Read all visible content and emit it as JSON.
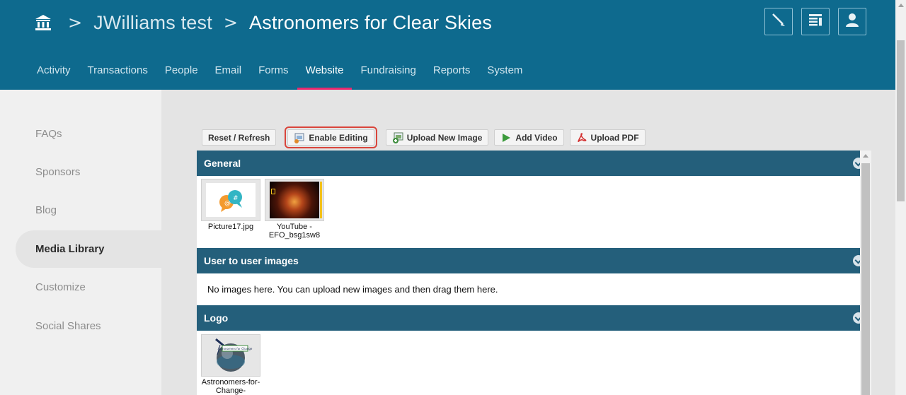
{
  "header": {
    "breadcrumb": [
      "JWilliams test",
      "Astronomers for Clear Skies"
    ],
    "separator": ">"
  },
  "nav": {
    "items": [
      "Activity",
      "Transactions",
      "People",
      "Email",
      "Forms",
      "Website",
      "Fundraising",
      "Reports",
      "System"
    ],
    "active": "Website"
  },
  "sidebar": {
    "items": [
      "FAQs",
      "Sponsors",
      "Blog",
      "Media Library",
      "Customize",
      "Social Shares"
    ],
    "active": "Media Library"
  },
  "toolbar": {
    "reset_label": "Reset / Refresh",
    "enable_editing_label": "Enable Editing",
    "upload_image_label": "Upload New Image",
    "add_video_label": "Add Video",
    "upload_pdf_label": "Upload PDF"
  },
  "sections": [
    {
      "title": "General",
      "items": [
        {
          "caption": "Picture17.jpg"
        },
        {
          "caption": "YouTube - EFO_bsg1sw8"
        }
      ]
    },
    {
      "title": "User to user images",
      "empty_message": "No images here. You can upload new images and then drag them here."
    },
    {
      "title": "Logo",
      "items": [
        {
          "caption": "Astronomers-for-Change-"
        }
      ]
    }
  ],
  "colors": {
    "header_bg": "#0e6a8e",
    "section_header_bg": "#245f7b",
    "active_underline": "#e8296f",
    "highlight_outline": "#d9453b"
  }
}
